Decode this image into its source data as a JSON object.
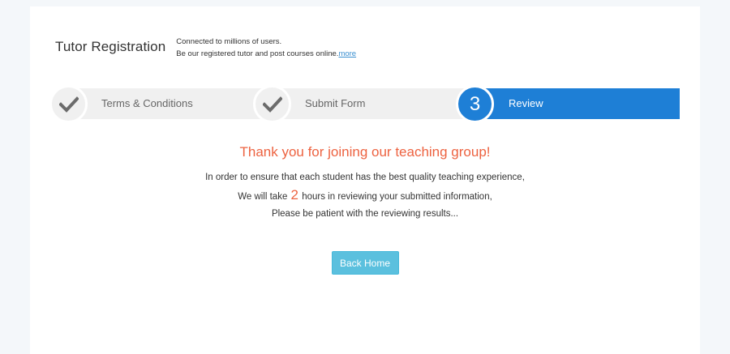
{
  "header": {
    "title": "Tutor Registration",
    "subtitle_line1": "Connected to millions of users.",
    "subtitle_line2": "Be our registered tutor and post courses online.",
    "more_link": "more"
  },
  "steps": [
    {
      "label": "Terms & Conditions",
      "status": "done",
      "icon": "check-icon"
    },
    {
      "label": "Submit Form",
      "status": "done",
      "icon": "check-icon"
    },
    {
      "label": "Review",
      "status": "active",
      "number": "3"
    }
  ],
  "message": {
    "thanks": "Thank you for joining our teaching group!",
    "line1": "In order to ensure that each student has the best quality teaching experience,",
    "line2_prefix": "We will take ",
    "hours": "2",
    "line2_suffix": " hours in reviewing your submitted information,",
    "line3": "Please be patient with the reviewing results..."
  },
  "back_button": {
    "label": "Back Home"
  },
  "colors": {
    "accent": "#1e7fd6",
    "highlight": "#ed6240",
    "button": "#5bc0de",
    "step_inactive": "#f0f0f0"
  }
}
